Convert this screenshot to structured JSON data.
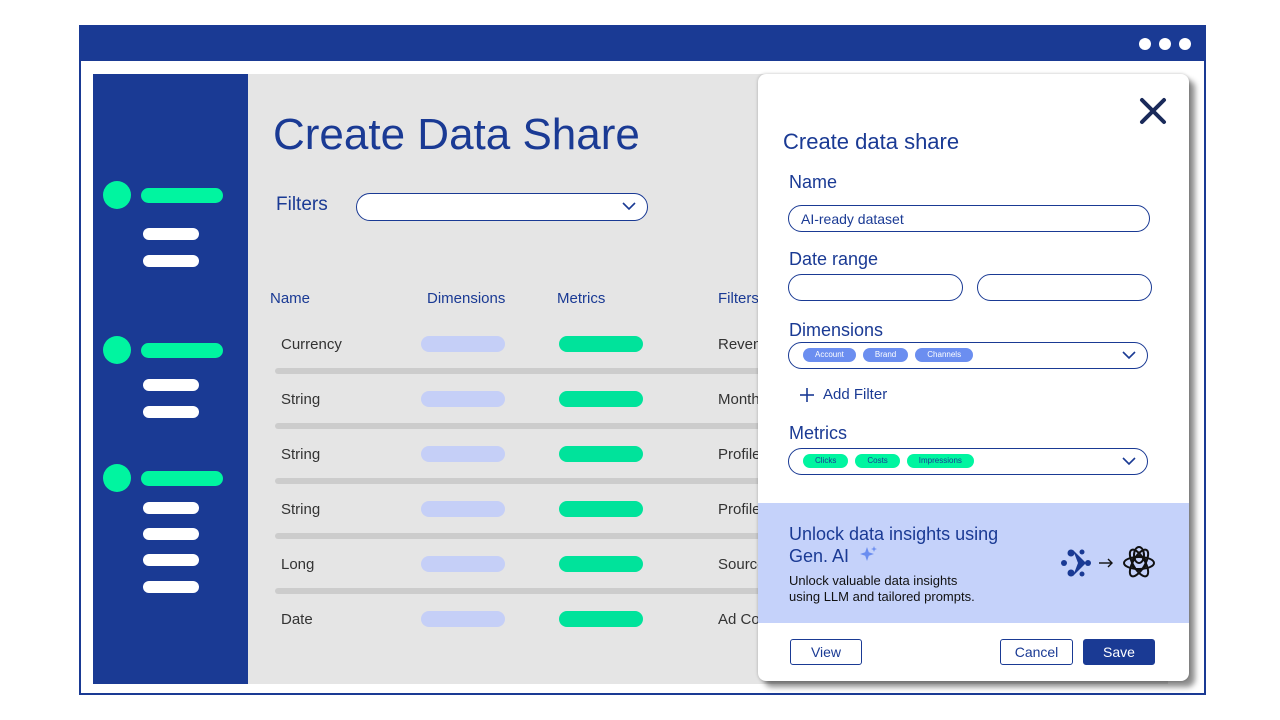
{
  "page": {
    "title": "Create Data Share",
    "filters_label": "Filters"
  },
  "table": {
    "headers": [
      "Name",
      "Dimensions",
      "Metrics",
      "Filters"
    ],
    "rows": [
      {
        "type": "Currency",
        "filter": "Reven"
      },
      {
        "type": "String",
        "filter": "Month"
      },
      {
        "type": "String",
        "filter": "Profile"
      },
      {
        "type": "String",
        "filter": "Profile"
      },
      {
        "type": "Long",
        "filter": "Source"
      },
      {
        "type": "Date",
        "filter": "Ad Co"
      }
    ]
  },
  "panel": {
    "title": "Create data share",
    "name_label": "Name",
    "name_value": "AI-ready dataset",
    "date_label": "Date range",
    "dimensions_label": "Dimensions",
    "dimension_chips": [
      "Account",
      "Brand",
      "Channels"
    ],
    "add_filter_label": "Add Filter",
    "metrics_label": "Metrics",
    "metric_chips": [
      "Clicks",
      "Costs",
      "Impressions"
    ],
    "promo": {
      "title_line1": "Unlock data insights using",
      "title_line2": "Gen. AI",
      "desc_line1": "Unlock valuable data insights",
      "desc_line2": "using LLM and tailored prompts."
    },
    "buttons": {
      "view": "View",
      "cancel": "Cancel",
      "save": "Save"
    }
  },
  "colors": {
    "brand": "#1a3a94",
    "accent_green": "#00f5a0",
    "chip_blue": "#6b8ef0",
    "promo_bg": "#c5d2fa",
    "content_bg": "#e5e5e5"
  },
  "icons": [
    "window-menu-dots-icon",
    "chevron-down-icon",
    "close-icon",
    "plus-icon",
    "sparkle-icon",
    "connector-logo-icon",
    "arrow-right-icon",
    "llm-logo-icon"
  ]
}
